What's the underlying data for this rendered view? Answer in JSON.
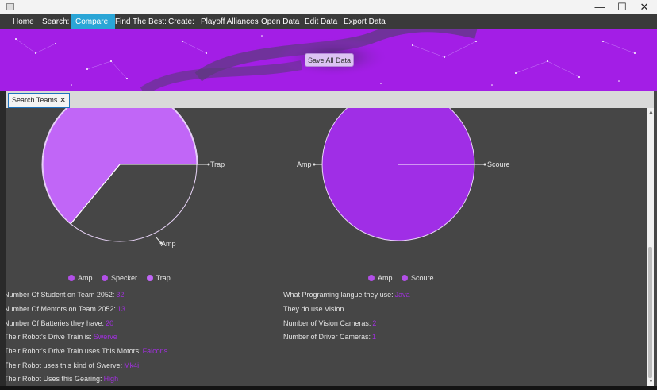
{
  "window": {
    "minimize_glyph": "—",
    "maximize_glyph": "☐",
    "close_glyph": "✕"
  },
  "menu": [
    {
      "label": "Home",
      "active": false
    },
    {
      "label": "Search:",
      "active": false
    },
    {
      "label": "Compare:",
      "active": true
    },
    {
      "label": "Find The Best:",
      "active": false
    },
    {
      "label": "Create:",
      "active": false
    },
    {
      "label": "Playoff Alliances",
      "active": false
    },
    {
      "label": "Open Data",
      "active": false
    },
    {
      "label": "Edit Data",
      "active": false
    },
    {
      "label": "Export Data",
      "active": false
    }
  ],
  "banner": {
    "save_label": "Save All Data",
    "color": "#a31ee6"
  },
  "tab": {
    "label": "Search Teams",
    "close": "✕"
  },
  "chart_data": [
    {
      "type": "pie",
      "slices": [
        {
          "label": "Amp",
          "value": 0.65
        },
        {
          "label": "Specker",
          "value": 0.0
        },
        {
          "label": "Trap",
          "value": 0.35
        }
      ],
      "legend": [
        "Amp",
        "Specker",
        "Trap"
      ],
      "legend_position": "bottom",
      "colors": [
        "#a02ee6",
        "#b63ff0",
        "#c166f7"
      ]
    },
    {
      "type": "pie",
      "slices": [
        {
          "label": "Amp",
          "value": 0.0
        },
        {
          "label": "Scoure",
          "value": 1.0
        }
      ],
      "legend": [
        "Amp",
        "Scoure"
      ],
      "legend_position": "bottom",
      "colors": [
        "#b63ff0",
        "#a02ee6"
      ]
    }
  ],
  "stats_left": [
    {
      "label": "Number Of Student on Team 2052:",
      "value": "32"
    },
    {
      "label": "Number Of Mentors on Team 2052:",
      "value": "13"
    },
    {
      "label": "Number Of Batteries they have:",
      "value": "20"
    },
    {
      "label": "Their Robot's Drive Train is:",
      "value": "Swerve"
    },
    {
      "label": "Their Robot's Drive Train uses This Motors:",
      "value": "Falcons"
    },
    {
      "label": "Their Robot uses this kind of Swerve:",
      "value": "Mk4i"
    },
    {
      "label": "Their Robot Uses this Gearing:",
      "value": "High"
    }
  ],
  "stats_right": [
    {
      "label": "What Programing langue they use:",
      "value": "Java"
    },
    {
      "label": "They do use Vision",
      "value": ""
    },
    {
      "label": "Number of Vision Cameras:",
      "value": "2"
    },
    {
      "label": "Number of Driver Cameras:",
      "value": "1"
    }
  ]
}
